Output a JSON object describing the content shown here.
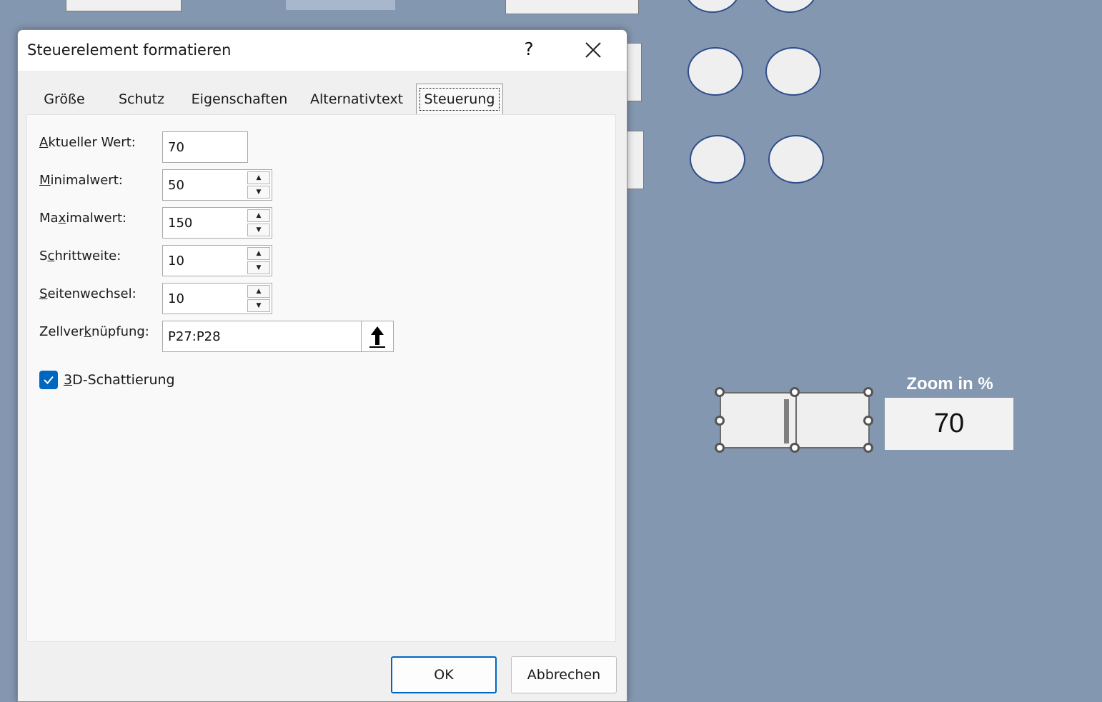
{
  "dialog": {
    "title": "Steuerelement formatieren",
    "help_label": "?",
    "tabs": [
      {
        "label": "Größe"
      },
      {
        "label": "Schutz"
      },
      {
        "label": "Eigenschaften"
      },
      {
        "label": "Alternativtext"
      },
      {
        "label": "Steuerung"
      }
    ],
    "active_tab": "Steuerung",
    "fields": {
      "current_value": {
        "label_key": "A",
        "label_rest": "ktueller Wert:",
        "value": "70"
      },
      "min_value": {
        "label_key": "M",
        "label_rest": "inimalwert:",
        "value": "50"
      },
      "max_value": {
        "label_pre": "Ma",
        "label_key": "x",
        "label_rest": "imalwert:",
        "value": "150"
      },
      "step": {
        "label_pre": "S",
        "label_key": "c",
        "label_rest": "hrittweite:",
        "value": "10"
      },
      "page_change": {
        "label_key": "S",
        "label_rest": "eitenwechsel:",
        "value": "10"
      },
      "cell_link": {
        "label_pre": "Zellver",
        "label_key": "k",
        "label_rest": "nüpfung:",
        "value": "P27:P28"
      }
    },
    "checkbox": {
      "label_key": "3",
      "label_rest": "D-Schattierung",
      "checked": true
    },
    "buttons": {
      "ok": "OK",
      "cancel": "Abbrechen"
    }
  },
  "sheet": {
    "zoom_label": "Zoom in %",
    "zoom_value": "70"
  },
  "colors": {
    "background": "#8497b0",
    "accent": "#0067c0"
  }
}
